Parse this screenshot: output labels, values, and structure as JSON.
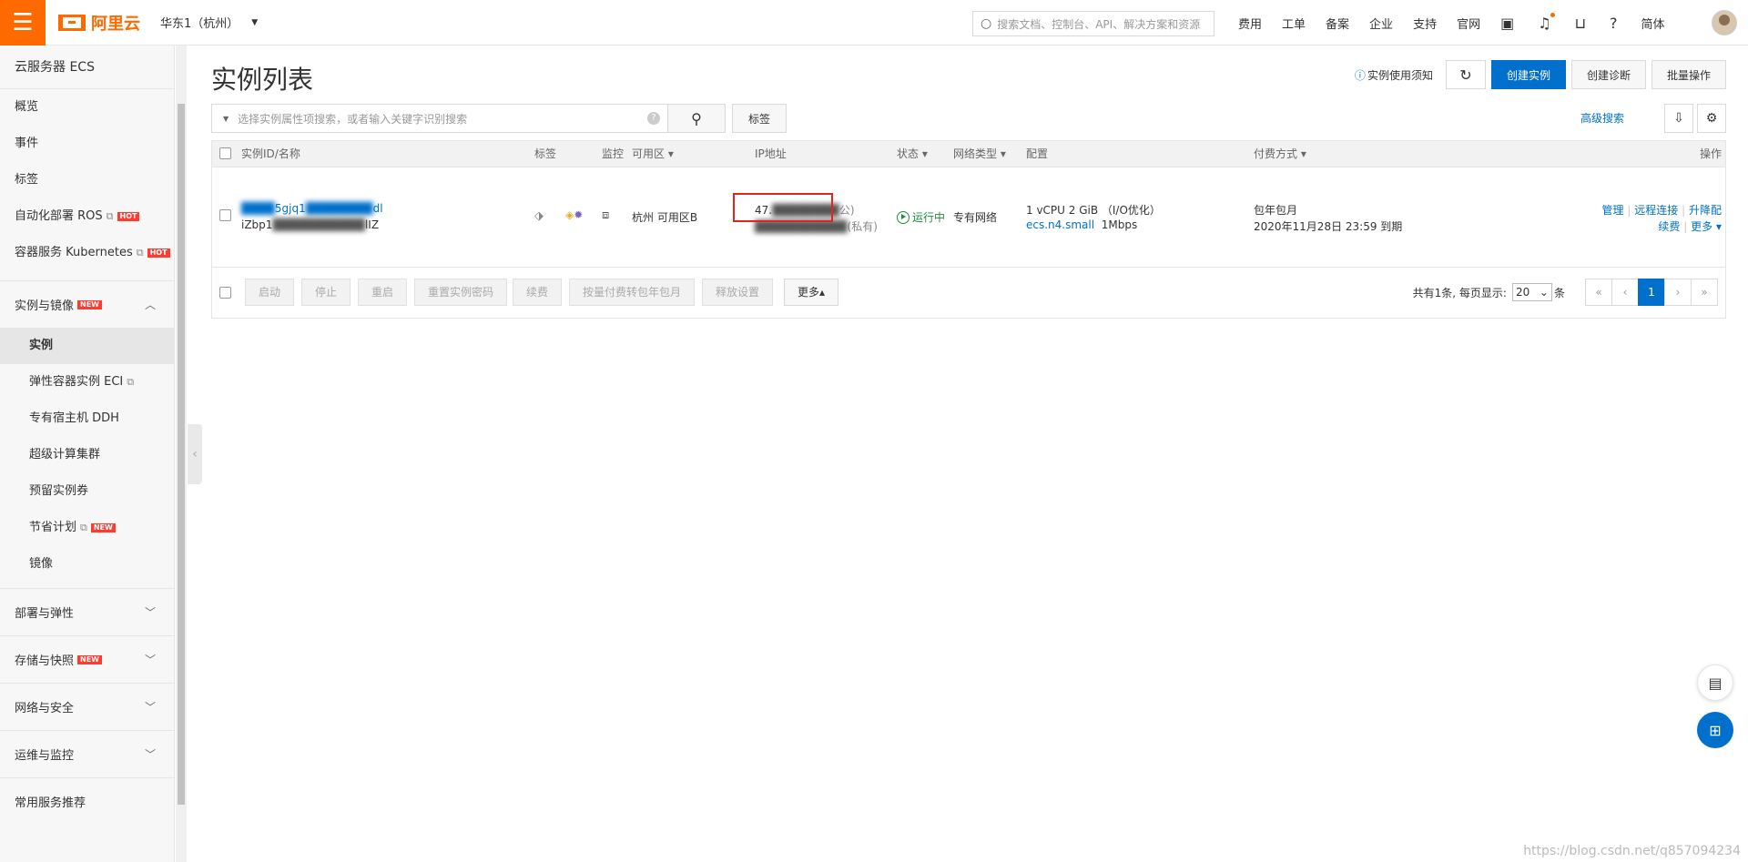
{
  "topbar": {
    "menu_icon": "menu-icon",
    "brand": "阿里云",
    "region": "华东1（杭州）",
    "search_placeholder": "搜索文档、控制台、API、解决方案和资源",
    "links": [
      "费用",
      "工单",
      "备案",
      "企业",
      "支持",
      "官网"
    ],
    "lang": "简体",
    "accent_color": "#ff6a00"
  },
  "sidebar": {
    "title": "云服务器 ECS",
    "items": [
      {
        "label": "概览"
      },
      {
        "label": "事件"
      },
      {
        "label": "标签"
      },
      {
        "label": "自动化部署 ROS",
        "badge": "HOT"
      },
      {
        "label": "容器服务 Kubernetes",
        "badge": "HOT"
      }
    ],
    "group_instances": {
      "label": "实例与镜像",
      "badge": "NEW"
    },
    "sub_items": [
      {
        "label": "实例"
      },
      {
        "label": "弹性容器实例 ECI"
      },
      {
        "label": "专有宿主机 DDH"
      },
      {
        "label": "超级计算集群"
      },
      {
        "label": "预留实例券"
      },
      {
        "label": "节省计划",
        "badge": "NEW"
      },
      {
        "label": "镜像"
      }
    ],
    "groups": [
      {
        "label": "部署与弹性"
      },
      {
        "label": "存储与快照",
        "badge": "NEW"
      },
      {
        "label": "网络与安全"
      },
      {
        "label": "运维与监控"
      },
      {
        "label": "常用服务推荐"
      }
    ]
  },
  "header": {
    "title": "实例列表",
    "notice": "实例使用须知",
    "create_instance": "创建实例",
    "create_diagnosis": "创建诊断",
    "batch_ops": "批量操作"
  },
  "filter": {
    "placeholder": "选择实例属性项搜索，或者输入关键字识别搜索",
    "tag_button": "标签",
    "advanced_search": "高级搜索"
  },
  "table": {
    "columns": {
      "id_name": "实例ID/名称",
      "tags": "标签",
      "monitor": "监控",
      "zone": "可用区",
      "ip": "IP地址",
      "status": "状态",
      "network": "网络类型",
      "config": "配置",
      "billing": "付费方式",
      "actions": "操作"
    },
    "rows": [
      {
        "name_partial": "5gjq1",
        "name_tail": "dl",
        "id_partial": "iZbp1",
        "id_tail": "lIZ",
        "zone": "杭州 可用区B",
        "ip_public": "47.",
        "ip_public_suffix": "公)",
        "ip_private_suffix": "(私有)",
        "status": "运行中",
        "network": "专有网络",
        "config_line1": "1 vCPU 2 GiB （I/O优化）",
        "config_type": "ecs.n4.small",
        "config_bandwidth": "1Mbps",
        "billing_type": "包年包月",
        "expire": "2020年11月28日 23:59 到期",
        "actions": [
          "管理",
          "远程连接",
          "升降配",
          "续费",
          "更多"
        ]
      }
    ]
  },
  "footer": {
    "buttons": [
      "启动",
      "停止",
      "重启",
      "重置实例密码",
      "续费",
      "按量付费转包年包月",
      "释放设置"
    ],
    "more": "更多▴",
    "total_text": "共有1条, 每页显示:",
    "page_size": "20",
    "unit": "条",
    "pages": [
      "«",
      "‹",
      "1",
      "›",
      "»"
    ],
    "current_page": "1"
  },
  "watermark": "https://blog.csdn.net/q857094234"
}
